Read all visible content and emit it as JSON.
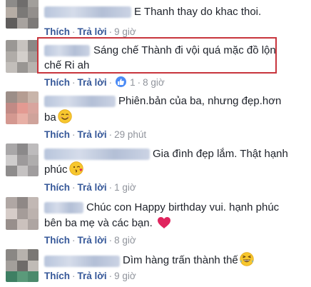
{
  "comments": [
    {
      "text_lines": [
        "E Thanh thay do khac thoi."
      ],
      "like_label": "Thích",
      "reply_label": "Trả lời",
      "time": "9 giờ"
    },
    {
      "text_lines": [
        "Sáng chế Thành đi vội quá mặc đồ lộn",
        "chế Ri ah"
      ],
      "like_label": "Thích",
      "reply_label": "Trả lời",
      "reaction_count": "1",
      "time": "8 giờ",
      "highlighted": true
    },
    {
      "text_lines": [
        "Phiên.bản của ba, nhưng đẹp.hơn",
        "ba"
      ],
      "like_label": "Thích",
      "reply_label": "Trả lời",
      "time": "29 phút",
      "emoji": "smile-emoji"
    },
    {
      "text_lines": [
        "Gia đình đẹp lắm. Thật hạnh",
        "phúc"
      ],
      "like_label": "Thích",
      "reply_label": "Trả lời",
      "time": "1 giờ",
      "emoji": "kiss-emoji"
    },
    {
      "text_lines": [
        "Chúc con Happy birthday vui. hạnh phúc",
        "bên ba mẹ và các bạn."
      ],
      "like_label": "Thích",
      "reply_label": "Trả lời",
      "time": "8 giờ",
      "emoji": "heart-emoji"
    },
    {
      "text_lines": [
        "Dìm hàng trấn thành thế"
      ],
      "like_label": "Thích",
      "reply_label": "Trả lời",
      "time": "9 giờ",
      "emoji": "laughing-emoji"
    }
  ],
  "colors": {
    "link": "#365899",
    "meta": "#90949c",
    "text": "#1d2129",
    "highlight_border": "#c8353d",
    "like_badge": "#4c8bf5"
  }
}
